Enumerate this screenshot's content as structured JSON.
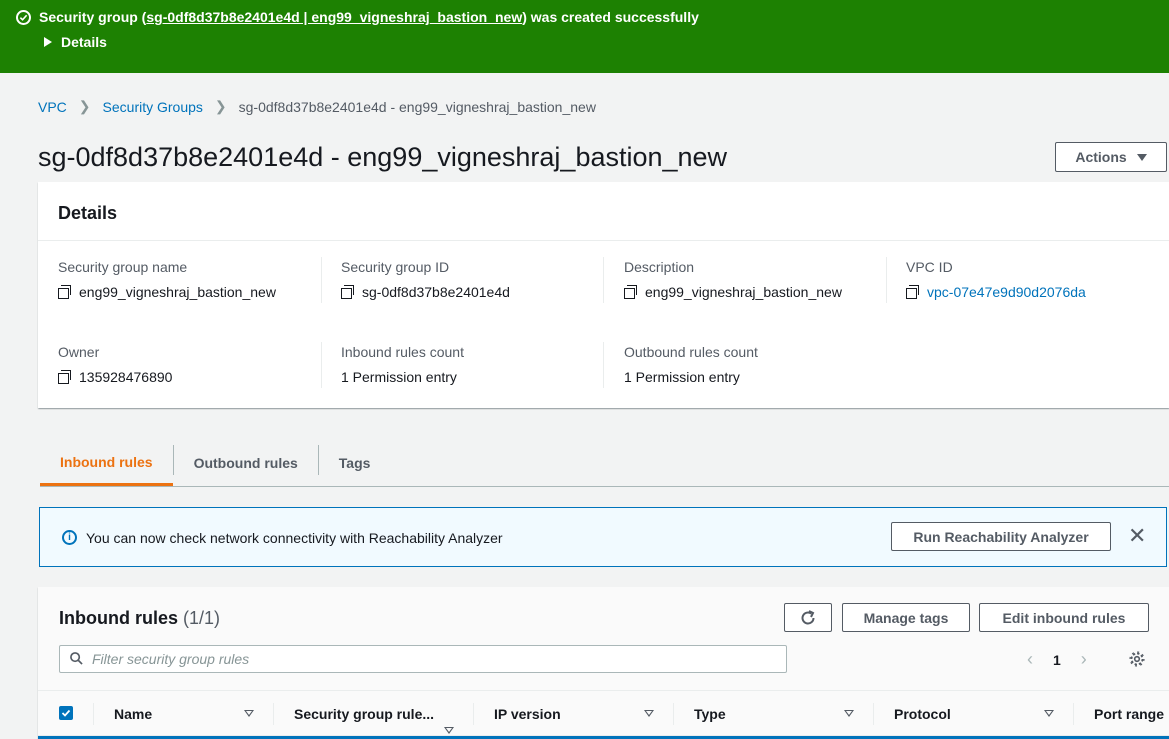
{
  "flash": {
    "prefix": "Security group (",
    "link": "sg-0df8d37b8e2401e4d | eng99_vigneshraj_bastion_new",
    "suffix": ") was created successfully",
    "details_label": "Details"
  },
  "breadcrumb": {
    "items": [
      "VPC",
      "Security Groups"
    ],
    "current": "sg-0df8d37b8e2401e4d - eng99_vigneshraj_bastion_new"
  },
  "page": {
    "title": "sg-0df8d37b8e2401e4d - eng99_vigneshraj_bastion_new",
    "actions_label": "Actions"
  },
  "details": {
    "heading": "Details",
    "fields": [
      {
        "label": "Security group name",
        "value": "eng99_vigneshraj_bastion_new"
      },
      {
        "label": "Security group ID",
        "value": "sg-0df8d37b8e2401e4d"
      },
      {
        "label": "Description",
        "value": "eng99_vigneshraj_bastion_new"
      },
      {
        "label": "VPC ID",
        "value": "vpc-07e47e9d90d2076da"
      },
      {
        "label": "Owner",
        "value": "135928476890"
      },
      {
        "label": "Inbound rules count",
        "value": "1 Permission entry"
      },
      {
        "label": "Outbound rules count",
        "value": "1 Permission entry"
      }
    ]
  },
  "tabs": [
    "Inbound rules",
    "Outbound rules",
    "Tags"
  ],
  "alert": {
    "message": "You can now check network connectivity with Reachability Analyzer",
    "button": "Run Reachability Analyzer",
    "close": "✕"
  },
  "inbound": {
    "title": "Inbound rules",
    "count": "(1/1)",
    "manage_tags": "Manage tags",
    "edit": "Edit inbound rules",
    "filter_placeholder": "Filter security group rules",
    "page": "1",
    "columns": [
      "Name",
      "Security group rule...",
      "IP version",
      "Type",
      "Protocol",
      "Port range"
    ]
  },
  "colors": {
    "success": "#1d8102",
    "link": "#0073bb",
    "active_tab": "#ec7211",
    "info_bg": "#f1faff"
  }
}
